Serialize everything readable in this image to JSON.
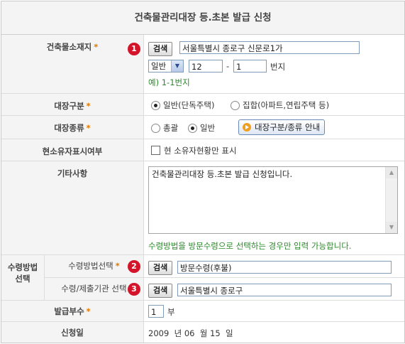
{
  "title": "건축물관리대장 등.초본 발급 신청",
  "location": {
    "label": "건축물소재지",
    "required_mark": "*",
    "badge": "1",
    "search_label": "검색",
    "address_value": "서울특별시 종로구 신문로1가",
    "lot_type": "일반",
    "main_no": "12",
    "dash": "-",
    "sub_no": "1",
    "unit": "번지",
    "example": "예) 1-1번지"
  },
  "ledger_class": {
    "label": "대장구분",
    "required_mark": "*",
    "options": [
      "일반(단독주택)",
      "집합(아파트,연립주택 등)"
    ],
    "selected": 0
  },
  "ledger_type": {
    "label": "대장종류",
    "required_mark": "*",
    "options": [
      "총괄",
      "일반"
    ],
    "selected": 1,
    "guide_button": "대장구분/종류 안내"
  },
  "owner_display": {
    "label": "현소유자표시여부",
    "checkbox_label": "현 소유자현황만 표시",
    "checked": false
  },
  "other": {
    "label": "기타사항",
    "textarea_value": "건축물관리대장 등.초본 발급 신청입니다.",
    "note": "수령방법을 방문수령으로 선택하는 경우만 입력 가능합니다."
  },
  "receipt": {
    "group_label_line1": "수령방법",
    "group_label_line2": "선택",
    "method_label": "수령방법선택",
    "required_mark": "*",
    "method_badge": "2",
    "method_search": "검색",
    "method_value": "방문수령(후불)",
    "office_label": "수령/제출기관 선택",
    "office_badge": "3",
    "office_search": "검색",
    "office_value": "서울특별시 종로구"
  },
  "copies": {
    "label": "발급부수",
    "required_mark": "*",
    "value": "1",
    "unit": "부"
  },
  "apply_date": {
    "label": "신청일",
    "year": "2009",
    "year_unit": "년",
    "month": "06",
    "month_unit": "월",
    "day": "15",
    "day_unit": "일"
  },
  "colors": {
    "accent_orange": "#e07a00",
    "badge_red": "#d4142a",
    "note_green": "#2a8a2a"
  }
}
